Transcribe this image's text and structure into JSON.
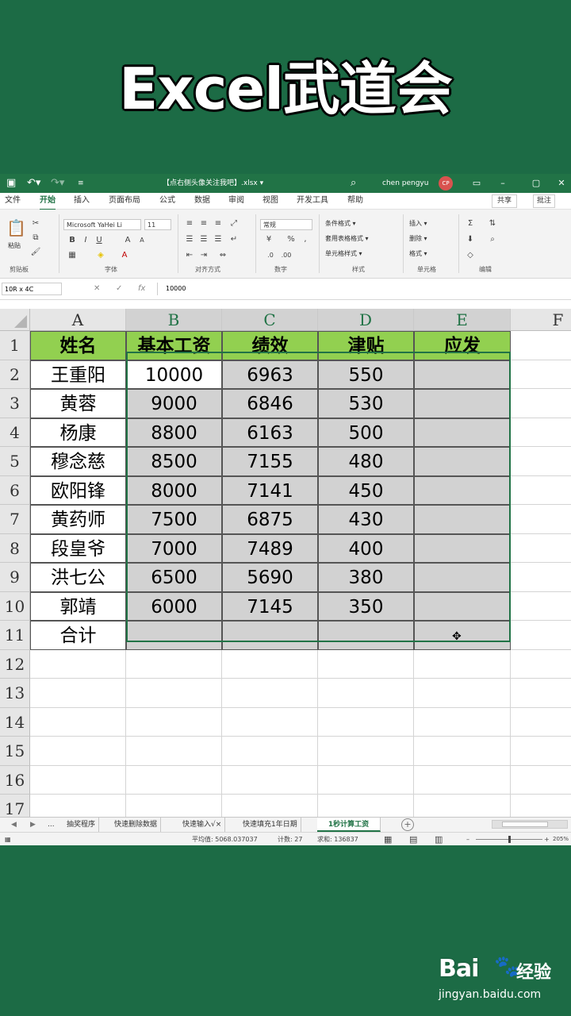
{
  "banner": {
    "title": "Excel武道会"
  },
  "titlebar": {
    "doc_title": "【点右侧头像关注我吧】.xlsx ▾",
    "user": "chen pengyu",
    "avatar": "CP",
    "qa_save_icon": "save-icon",
    "qa_undo_icon": "undo-icon"
  },
  "tabs": {
    "items": [
      "文件",
      "开始",
      "插入",
      "页面布局",
      "公式",
      "数据",
      "审阅",
      "视图",
      "开发工具",
      "帮助"
    ],
    "share": "共享",
    "comment": "批注"
  },
  "ribbon": {
    "font_name": "Microsoft YaHei Li",
    "font_size": "11",
    "number_format": "常规",
    "groups": [
      "剪贴板",
      "字体",
      "对齐方式",
      "数字",
      "样式",
      "单元格",
      "编辑"
    ],
    "paste_label": "粘贴",
    "styles": [
      "条件格式 ▾",
      "套用表格格式 ▾",
      "单元格样式 ▾"
    ],
    "cells": [
      "插入 ▾",
      "删除 ▾",
      "格式 ▾"
    ]
  },
  "formula_bar": {
    "name_box": "10R x 4C",
    "fx": "fx",
    "formula": "10000"
  },
  "columns": [
    "A",
    "B",
    "C",
    "D",
    "E",
    "F"
  ],
  "rows": [
    "1",
    "2",
    "3",
    "4",
    "5",
    "6",
    "7",
    "8",
    "9",
    "10",
    "11",
    "12",
    "13",
    "14",
    "15",
    "16",
    "17"
  ],
  "table": {
    "headers": [
      "姓名",
      "基本工资",
      "绩效",
      "津贴",
      "应发"
    ],
    "data": [
      [
        "王重阳",
        "10000",
        "6963",
        "550",
        ""
      ],
      [
        "黄蓉",
        "9000",
        "6846",
        "530",
        ""
      ],
      [
        "杨康",
        "8800",
        "6163",
        "500",
        ""
      ],
      [
        "穆念慈",
        "8500",
        "7155",
        "480",
        ""
      ],
      [
        "欧阳锋",
        "8000",
        "7141",
        "450",
        ""
      ],
      [
        "黄药师",
        "7500",
        "6875",
        "430",
        ""
      ],
      [
        "段皇爷",
        "7000",
        "7489",
        "400",
        ""
      ],
      [
        "洪七公",
        "6500",
        "5690",
        "380",
        ""
      ],
      [
        "郭靖",
        "6000",
        "7145",
        "350",
        ""
      ],
      [
        "合计",
        "",
        "",
        "",
        ""
      ]
    ]
  },
  "sheet_tabs": {
    "more": "...",
    "items": [
      "抽奖程序",
      "快速删除数据",
      "快速输入√×",
      "快速填充1年日期",
      "1秒计算工资"
    ],
    "active_index": 4,
    "add": "+"
  },
  "statusbar": {
    "average": "平均值: 5068.037037",
    "count": "计数: 27",
    "sum": "求和: 136837",
    "zoom": "205%"
  },
  "watermark": {
    "brand": "Bai",
    "paw": "🐾",
    "cn": "经验",
    "url": "jingyan.baidu.com"
  }
}
